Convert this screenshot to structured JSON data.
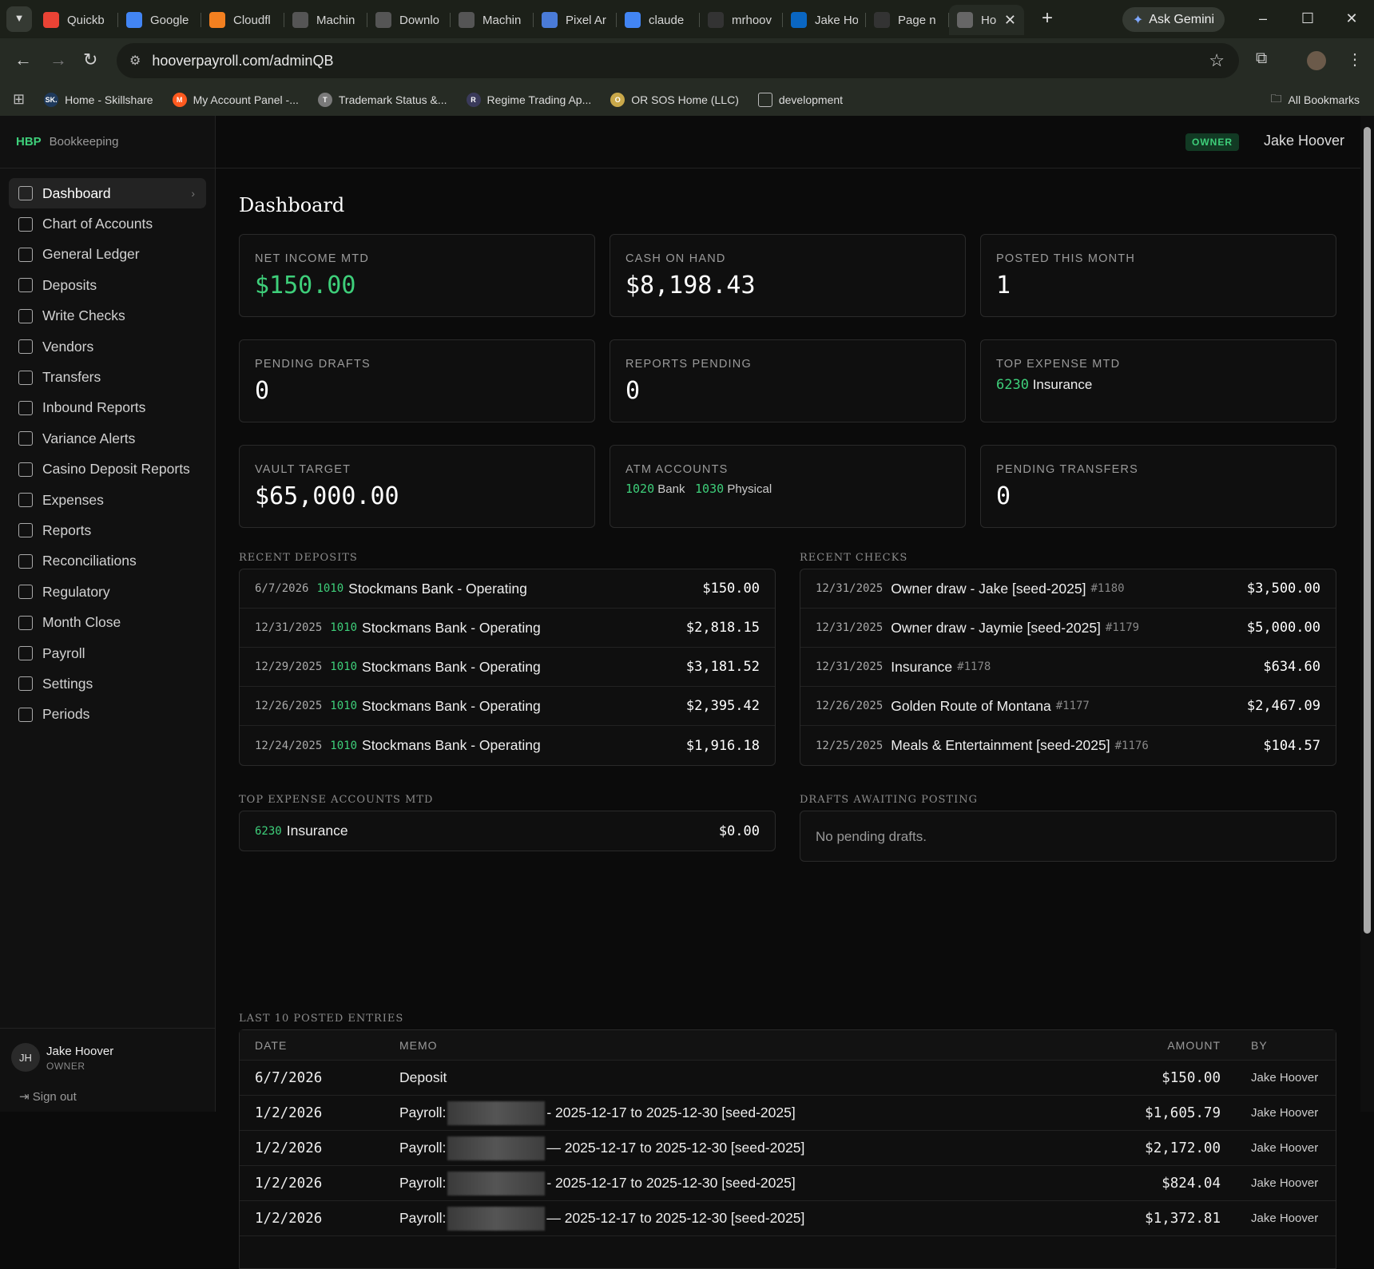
{
  "browser": {
    "tabs": [
      {
        "label": "Quickb",
        "icon": "gmail-icon",
        "color": "#ea4335"
      },
      {
        "label": "Google",
        "icon": "google-icon",
        "color": "#4285f4"
      },
      {
        "label": "Cloudfl",
        "icon": "cloudflare-icon",
        "color": "#f38020"
      },
      {
        "label": "Machin",
        "icon": "dots-icon",
        "color": "#555"
      },
      {
        "label": "Downlo",
        "icon": "dots-icon",
        "color": "#555"
      },
      {
        "label": "Machin",
        "icon": "dots-icon",
        "color": "#555"
      },
      {
        "label": "Pixel Ar",
        "icon": "gemini-icon",
        "color": "#4a7bd8"
      },
      {
        "label": "claude",
        "icon": "google-icon",
        "color": "#4285f4"
      },
      {
        "label": "mrhoov",
        "icon": "github-icon",
        "color": "#333"
      },
      {
        "label": "Jake Ho",
        "icon": "linkedin-icon",
        "color": "#0a66c2"
      },
      {
        "label": "Page n",
        "icon": "github-icon",
        "color": "#333"
      },
      {
        "label": "Ho",
        "icon": "globe-icon",
        "color": "#666",
        "active": true
      }
    ],
    "ask_gemini": "Ask Gemini",
    "url": "hooverpayroll.com/adminQB",
    "bookmarks": [
      {
        "label": "Home - Skillshare",
        "badge": "SK."
      },
      {
        "label": "My Account Panel -...",
        "badge": "M"
      },
      {
        "label": "Trademark Status &...",
        "badge": "T"
      },
      {
        "label": "Regime Trading Ap...",
        "badge": "R"
      },
      {
        "label": "OR SOS Home (LLC)",
        "badge": "O"
      },
      {
        "label": "development",
        "badge": ""
      }
    ],
    "all_bookmarks": "All Bookmarks"
  },
  "brand": {
    "short": "HBP",
    "name": "Bookkeeping"
  },
  "sidebar": {
    "items": [
      {
        "label": "Dashboard",
        "active": true
      },
      {
        "label": "Chart of Accounts"
      },
      {
        "label": "General Ledger"
      },
      {
        "label": "Deposits"
      },
      {
        "label": "Write Checks"
      },
      {
        "label": "Vendors"
      },
      {
        "label": "Transfers"
      },
      {
        "label": "Inbound Reports"
      },
      {
        "label": "Variance Alerts"
      },
      {
        "label": "Casino Deposit Reports"
      },
      {
        "label": "Expenses"
      },
      {
        "label": "Reports"
      },
      {
        "label": "Reconciliations"
      },
      {
        "label": "Regulatory"
      },
      {
        "label": "Month Close"
      },
      {
        "label": "Payroll"
      },
      {
        "label": "Settings"
      },
      {
        "label": "Periods"
      }
    ],
    "user": {
      "initials": "JH",
      "name": "Jake Hoover",
      "role": "OWNER"
    },
    "sign_out": "Sign out"
  },
  "header": {
    "badge": "OWNER",
    "user": "Jake Hoover"
  },
  "page_title": "Dashboard",
  "cards": {
    "net_income": {
      "label": "NET INCOME MTD",
      "value": "$150.00"
    },
    "cash": {
      "label": "CASH ON HAND",
      "value": "$8,198.43"
    },
    "posted": {
      "label": "POSTED THIS MONTH",
      "value": "1"
    },
    "drafts": {
      "label": "PENDING DRAFTS",
      "value": "0"
    },
    "reports": {
      "label": "REPORTS PENDING",
      "value": "0"
    },
    "top_expense": {
      "label": "TOP EXPENSE MTD",
      "acct": "6230",
      "name": "Insurance"
    },
    "vault": {
      "label": "VAULT TARGET",
      "value": "$65,000.00"
    },
    "atm": {
      "label": "ATM ACCOUNTS",
      "acct1": "1020",
      "name1": "Bank",
      "acct2": "1030",
      "name2": "Physical"
    },
    "transfers": {
      "label": "PENDING TRANSFERS",
      "value": "0"
    }
  },
  "recent_deposits": {
    "title": "RECENT DEPOSITS",
    "rows": [
      {
        "date": "6/7/2026",
        "acct": "1010",
        "name": "Stockmans Bank - Operating",
        "amount": "$150.00"
      },
      {
        "date": "12/31/2025",
        "acct": "1010",
        "name": "Stockmans Bank - Operating",
        "amount": "$2,818.15"
      },
      {
        "date": "12/29/2025",
        "acct": "1010",
        "name": "Stockmans Bank - Operating",
        "amount": "$3,181.52"
      },
      {
        "date": "12/26/2025",
        "acct": "1010",
        "name": "Stockmans Bank - Operating",
        "amount": "$2,395.42"
      },
      {
        "date": "12/24/2025",
        "acct": "1010",
        "name": "Stockmans Bank - Operating",
        "amount": "$1,916.18"
      }
    ]
  },
  "recent_checks": {
    "title": "RECENT CHECKS",
    "rows": [
      {
        "date": "12/31/2025",
        "payee": "Owner draw - Jake [seed-2025]",
        "num": "#1180",
        "amount": "$3,500.00"
      },
      {
        "date": "12/31/2025",
        "payee": "Owner draw - Jaymie [seed-2025]",
        "num": "#1179",
        "amount": "$5,000.00"
      },
      {
        "date": "12/31/2025",
        "payee": "Insurance",
        "num": "#1178",
        "amount": "$634.60"
      },
      {
        "date": "12/26/2025",
        "payee": "Golden Route of Montana",
        "num": "#1177",
        "amount": "$2,467.09"
      },
      {
        "date": "12/25/2025",
        "payee": "Meals & Entertainment [seed-2025]",
        "num": "#1176",
        "amount": "$104.57"
      }
    ]
  },
  "top_expense_accounts": {
    "title": "TOP EXPENSE ACCOUNTS MTD",
    "rows": [
      {
        "acct": "6230",
        "name": "Insurance",
        "amount": "$0.00"
      }
    ]
  },
  "drafts_awaiting": {
    "title": "DRAFTS AWAITING POSTING",
    "empty": "No pending drafts."
  },
  "ledger": {
    "title": "LAST 10 POSTED ENTRIES",
    "headers": [
      "DATE",
      "MEMO",
      "AMOUNT",
      "BY"
    ],
    "rows": [
      {
        "date": "6/7/2026",
        "memo": "Deposit",
        "redacted": false,
        "suffix": "",
        "amount": "$150.00",
        "by": "Jake Hoover"
      },
      {
        "date": "1/2/2026",
        "memo": "Payroll:",
        "redacted": true,
        "suffix": "- 2025-12-17 to 2025-12-30 [seed-2025]",
        "amount": "$1,605.79",
        "by": "Jake Hoover"
      },
      {
        "date": "1/2/2026",
        "memo": "Payroll:",
        "redacted": true,
        "suffix": "— 2025-12-17 to 2025-12-30 [seed-2025]",
        "amount": "$2,172.00",
        "by": "Jake Hoover"
      },
      {
        "date": "1/2/2026",
        "memo": "Payroll:",
        "redacted": true,
        "suffix": "- 2025-12-17 to 2025-12-30 [seed-2025]",
        "amount": "$824.04",
        "by": "Jake Hoover"
      },
      {
        "date": "1/2/2026",
        "memo": "Payroll:",
        "redacted": true,
        "suffix": "— 2025-12-17 to 2025-12-30 [seed-2025]",
        "amount": "$1,372.81",
        "by": "Jake Hoover"
      }
    ]
  }
}
